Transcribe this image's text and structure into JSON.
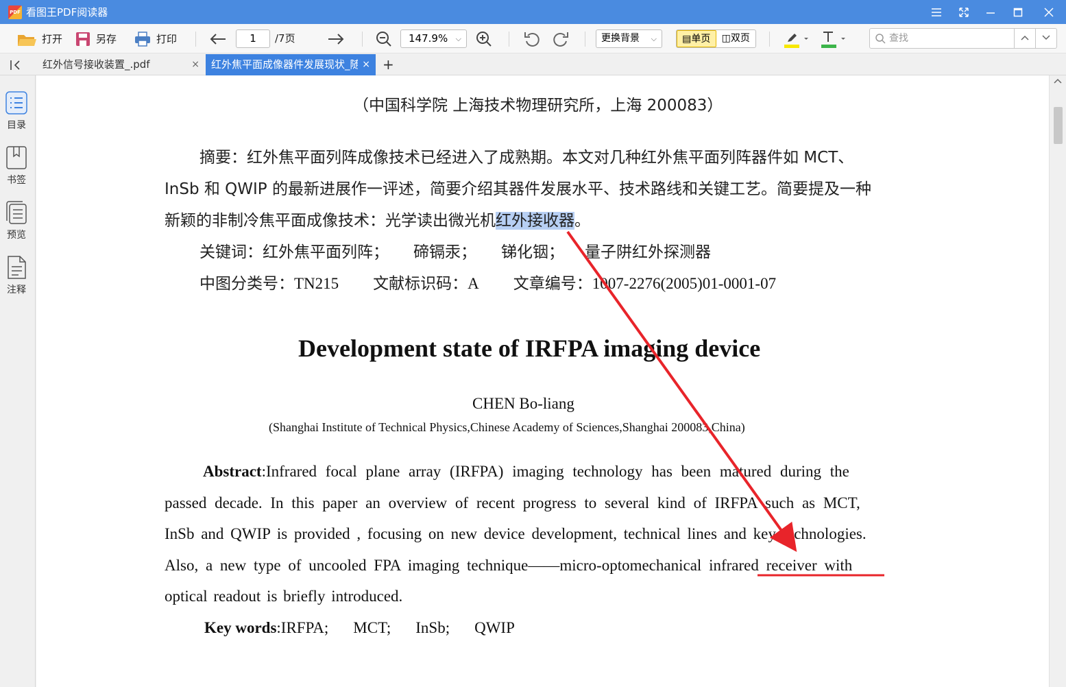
{
  "app": {
    "title": "看图王PDF阅读器",
    "logo_text": "PDF"
  },
  "toolbar": {
    "open_label": "打开",
    "saveas_label": "另存",
    "print_label": "打印",
    "page_current": "1",
    "page_total": "/7页",
    "zoom": "147.9%",
    "background_label": "更换背景",
    "single_page_label": "单页",
    "double_page_label": "双页",
    "search_placeholder": "查找"
  },
  "tabs": [
    {
      "label": "红外信号接收装置_.pdf",
      "close": "×"
    },
    {
      "label": "红外焦平面成像器件发展现状_随",
      "close": "×"
    }
  ],
  "tabs_add": "+",
  "sidebar": {
    "toc": "目录",
    "bookmarks": "书签",
    "preview": "预览",
    "annotations": "注释"
  },
  "doc": {
    "affiliation_cn": "（中国科学院 上海技术物理研究所，上海 200083）",
    "abstract_cn_l1": "摘要：红外焦平面列阵成像技术已经进入了成熟期。本文对几种红外焦平面列阵器件如 MCT、",
    "abstract_cn_l2": "InSb 和 QWIP 的最新进展作一评述，简要介绍其器件发展水平、技术路线和关键工艺。简要提及一种",
    "abstract_cn_l3_pre": "新颖的非制冷焦平面成像技术：光学读出微光机",
    "abstract_cn_l3_hl": "红外接收器",
    "abstract_cn_l3_post": "。",
    "keywords_cn_label": "关键词：",
    "keywords_cn": [
      "红外焦平面列阵；",
      "碲镉汞；",
      "锑化铟；",
      "量子阱红外探测器"
    ],
    "class_label": "中图分类号：",
    "class_value": "TN215",
    "doccode_label": "文献标识码：",
    "doccode_value": "A",
    "article_label": "文章编号：",
    "article_value": "1007-2276(2005)01-0001-07",
    "title_en": "Development state of IRFPA imaging device",
    "author_en": "CHEN Bo-liang",
    "affiliation_en": "(Shanghai Institute of Technical Physics,Chinese Academy of Sciences,Shanghai 200083,China)",
    "abstract_en_label": "Abstract",
    "abstract_en_l1": ":Infrared focal plane array (IRFPA) imaging technology has been matured during the",
    "abstract_en_l2": "passed decade. In this paper an overview of recent progress to several kind of IRFPA such as MCT,",
    "abstract_en_l3": "InSb and QWIP is provided , focusing on new device development, technical lines and key technologies.",
    "abstract_en_l4_pre": "Also, a new type of uncooled FPA imaging technique——micro-optomechanical ",
    "abstract_en_l4_ul": "infrared receiver",
    "abstract_en_l4_post": " with",
    "abstract_en_l5": "optical readout is briefly introduced.",
    "keywords_en_label": "Key words",
    "keywords_en": [
      ":IRFPA;",
      "MCT;",
      "InSb;",
      "QWIP"
    ]
  },
  "colors": {
    "titlebar": "#4a8be0",
    "active_tab": "#3d82e0",
    "highlight": "#b7cff3",
    "annotation_red": "#e8242a"
  }
}
